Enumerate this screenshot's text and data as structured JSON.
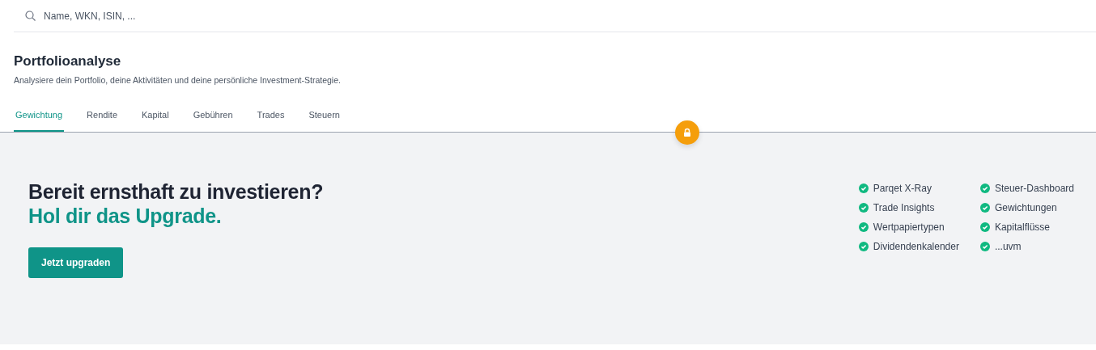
{
  "search": {
    "placeholder": "Name, WKN, ISIN, ..."
  },
  "page": {
    "title": "Portfolioanalyse",
    "subtitle": "Analysiere dein Portfolio, deine Aktivitäten und deine persönliche Investment-Strategie."
  },
  "tabs": [
    {
      "label": "Gewichtung",
      "selected": true
    },
    {
      "label": "Rendite",
      "selected": false
    },
    {
      "label": "Kapital",
      "selected": false
    },
    {
      "label": "Gebühren",
      "selected": false
    },
    {
      "label": "Trades",
      "selected": false
    },
    {
      "label": "Steuern",
      "selected": false
    }
  ],
  "upgrade": {
    "headline": "Bereit ernsthaft zu investieren?",
    "highlight": "Hol dir das Upgrade.",
    "button": "Jetzt upgraden",
    "features": [
      "Parqet X-Ray",
      "Trade Insights",
      "Wertpapiertypen",
      "Dividendenkalender",
      "Steuer-Dashboard",
      "Gewichtungen",
      "Kapitalflüsse",
      "...uvm"
    ]
  }
}
